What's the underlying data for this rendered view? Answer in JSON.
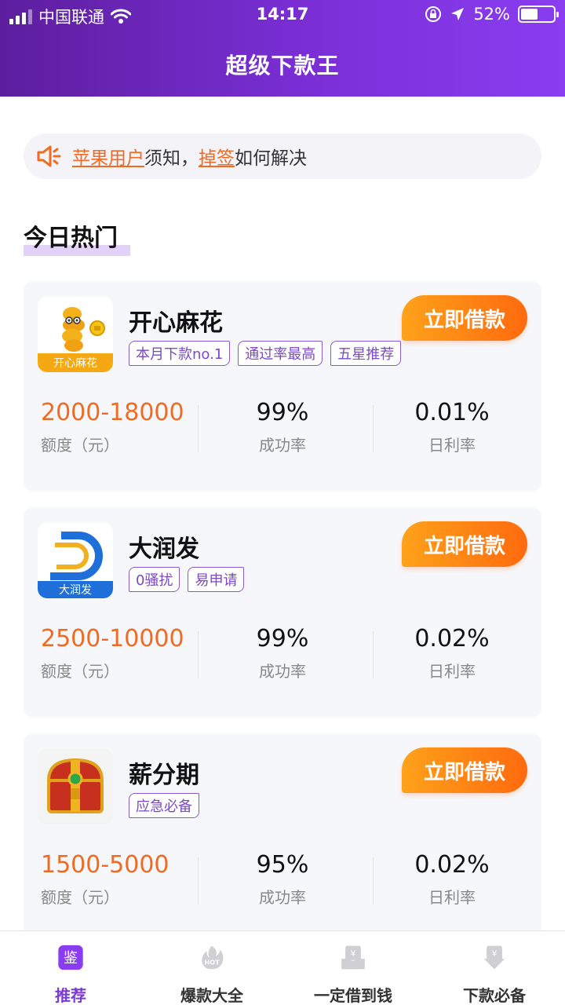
{
  "status_bar": {
    "carrier": "中国联通",
    "time": "14:17",
    "battery_percent": "52%",
    "battery_level": 0.52
  },
  "header": {
    "title": "超级下款王"
  },
  "notice": {
    "highlight_1": "苹果用户",
    "text_1": "须知，",
    "highlight_2": "掉签",
    "text_2": "如何解决"
  },
  "section": {
    "title": "今日热门"
  },
  "cards": [
    {
      "name": "开心麻花",
      "logo_text": "开心麻花",
      "tags": [
        "本月下款no.1",
        "通过率最高",
        "五星推荐"
      ],
      "button": "立即借款",
      "amount": "2000-18000",
      "amount_label": "额度（元）",
      "success_rate": "99%",
      "success_label": "成功率",
      "daily_rate": "0.01%",
      "daily_label": "日利率"
    },
    {
      "name": "大润发",
      "logo_text": "大润发",
      "tags": [
        "0骚扰",
        "易申请"
      ],
      "button": "立即借款",
      "amount": "2500-10000",
      "amount_label": "额度（元）",
      "success_rate": "99%",
      "success_label": "成功率",
      "daily_rate": "0.02%",
      "daily_label": "日利率"
    },
    {
      "name": "薪分期",
      "tags": [
        "应急必备"
      ],
      "button": "立即借款",
      "amount": "1500-5000",
      "amount_label": "额度（元）",
      "success_rate": "95%",
      "success_label": "成功率",
      "daily_rate": "0.02%",
      "daily_label": "日利率"
    }
  ],
  "tabbar": {
    "tabs": [
      {
        "label": "推荐",
        "icon": "recommend-icon",
        "icon_glyph": "鉴",
        "active": true
      },
      {
        "label": "爆款大全",
        "icon": "hot-flame-icon",
        "icon_glyph": "HOT",
        "active": false
      },
      {
        "label": "一定借到钱",
        "icon": "money-tray-icon",
        "icon_glyph": "¥",
        "active": false
      },
      {
        "label": "下款必备",
        "icon": "money-download-icon",
        "icon_glyph": "¥",
        "active": false
      }
    ]
  },
  "colors": {
    "header_start": "#5d1e9e",
    "header_end": "#8a3df0",
    "accent_orange": "#ef6b24",
    "button_start": "#ffa21a",
    "button_end": "#ff6a0e",
    "tag_purple": "#8a57d6",
    "active_tab": "#7a3ad6"
  }
}
